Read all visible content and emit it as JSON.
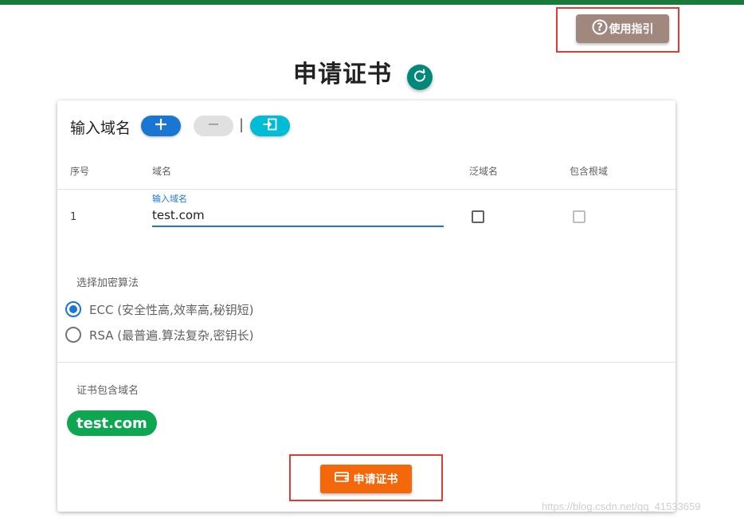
{
  "header": {
    "guide_button_label": "使用指引",
    "title": "申请证书"
  },
  "domain_section": {
    "title": "输入域名"
  },
  "table": {
    "columns": [
      "序号",
      "域名",
      "泛域名",
      "包含根域"
    ],
    "rows": [
      {
        "index": "1",
        "field_label": "输入域名",
        "domain": "test.com",
        "wildcard": false,
        "include_root": false
      }
    ]
  },
  "encryption": {
    "label": "选择加密算法",
    "options": [
      {
        "label": "ECC (安全性高,效率高,秘钥短)",
        "selected": true
      },
      {
        "label": "RSA (最普遍.算法复杂,密钥长)",
        "selected": false
      }
    ]
  },
  "cert_domains": {
    "label": "证书包含域名",
    "chips": [
      "test.com"
    ]
  },
  "actions": {
    "apply_label": "申请证书"
  },
  "watermark": "https://blog.csdn.net/qq_41533659",
  "colors": {
    "topbar": "#1a7a3c",
    "guide_button": "#a1887f",
    "refresh_button": "#00897b",
    "add_button": "#1976d2",
    "import_button": "#00bcd4",
    "chip": "#0ca750",
    "apply_button": "#f4670b",
    "highlight": "#e53935"
  }
}
